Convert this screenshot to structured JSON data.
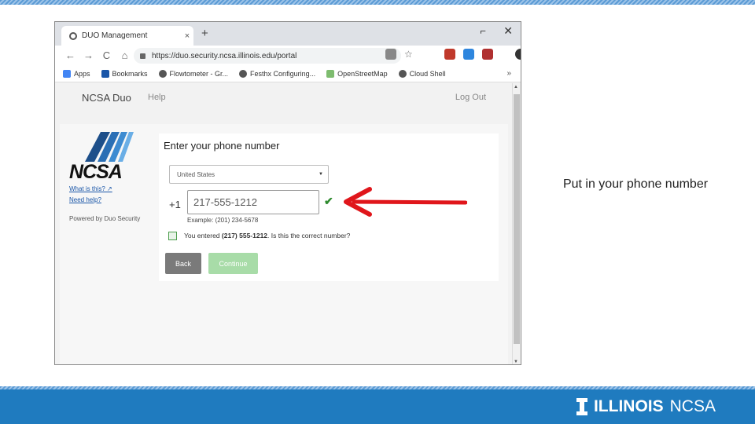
{
  "slide": {
    "caption": "Put in your phone number",
    "footer_logo_main": "ILLINOIS",
    "footer_logo_sub": "NCSA"
  },
  "browser": {
    "tab_title": "DUO Management",
    "tab_close": "×",
    "new_tab": "+",
    "window_min": "⌐",
    "window_close": "✕",
    "url": "https://duo.security.ncsa.illinois.edu/portal",
    "nav_back": "←",
    "nav_forward": "→",
    "nav_reload": "C",
    "nav_home": "⌂",
    "star": "☆",
    "menu": "⋮",
    "bookmarks": [
      {
        "label": "Apps",
        "icon": "apps-grid-icon",
        "color": "#4285f4"
      },
      {
        "label": "Bookmarks",
        "icon": "star-icon",
        "color": "#1a56a8"
      },
      {
        "label": "Flowtometer - Gr...",
        "icon": "globe-icon",
        "color": "#555555"
      },
      {
        "label": "Festhx Configuring...",
        "icon": "globe-icon",
        "color": "#555555"
      },
      {
        "label": "OpenStreetMap",
        "icon": "map-icon",
        "color": "#7ebc6f"
      },
      {
        "label": "Cloud Shell",
        "icon": "gear-icon",
        "color": "#555555"
      }
    ],
    "bookmarks_more": "»"
  },
  "site": {
    "brand": "NCSA Duo",
    "help": "Help",
    "logout": "Log Out"
  },
  "duo": {
    "logo_text": "NCSA",
    "what_is_this": "What is this? ↗",
    "need_help": "Need help?",
    "powered_by": "Powered by Duo Security",
    "title": "Enter your phone number",
    "country": "United States",
    "prefix": "+1",
    "phone_value": "217-555-1212",
    "example": "Example: (201) 234-5678",
    "confirm_prefix": "You entered ",
    "confirm_number": "(217) 555-1212",
    "confirm_suffix": ". Is this the correct number?",
    "back_label": "Back",
    "continue_label": "Continue",
    "checkmark": "✔"
  },
  "colors": {
    "footer_blue": "#1f7bbf",
    "arrow_red": "#e0161b",
    "continue_green": "#a8dca8",
    "check_green": "#2e8b2e"
  }
}
